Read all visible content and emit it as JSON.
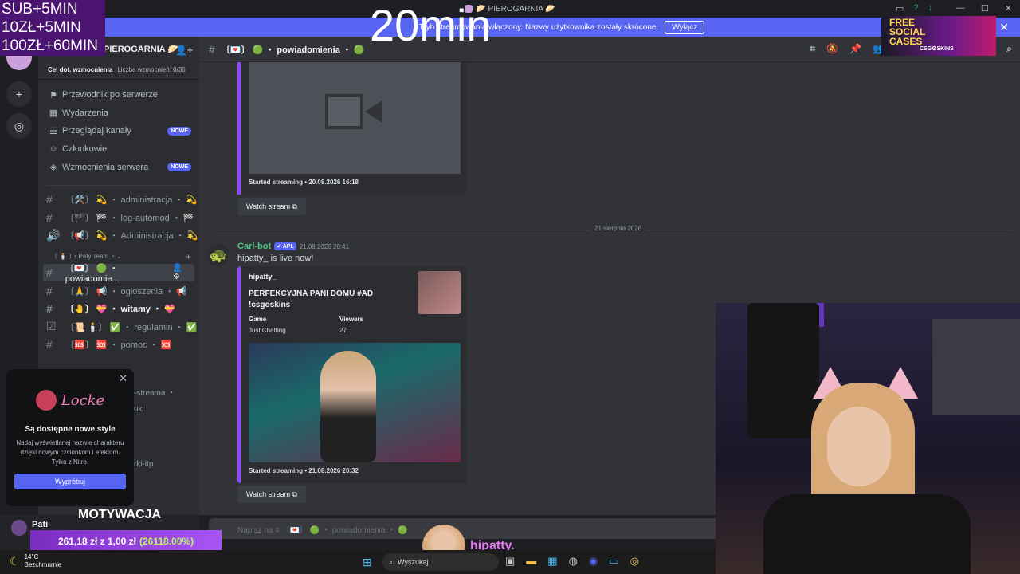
{
  "window": {
    "title": "🥟 PIEROGARNIA 🥟",
    "controls": [
      "—",
      "☐",
      "✕"
    ]
  },
  "notice": {
    "text": "Tryb streamowania włączony. Nazwy użytkownika zostały skrócone.",
    "button": "Wyłącz"
  },
  "server": {
    "name": "PIEROGARNIA 🥟",
    "boost_goal": "Cel dot. wzmocnienia",
    "boost_count": "Liczba wzmocnień: 0/36"
  },
  "nav": [
    {
      "icon": "compass-icon",
      "glyph": "⚑",
      "label": "Przewodnik po serwerze",
      "badge": ""
    },
    {
      "icon": "calendar-icon",
      "glyph": "▦",
      "label": "Wydarzenia",
      "badge": ""
    },
    {
      "icon": "browse-icon",
      "glyph": "☰",
      "label": "Przeglądaj kanały",
      "badge": "NOWE"
    },
    {
      "icon": "members-icon",
      "glyph": "☺",
      "label": "Członkowie",
      "badge": ""
    },
    {
      "icon": "boost-icon",
      "glyph": "◈",
      "label": "Wzmocnienia serwera",
      "badge": "NOWE"
    }
  ],
  "channels_top": [
    {
      "prefix": "#",
      "label": "〔🛠️〕 💫 ・ administracja ・ 💫"
    },
    {
      "prefix": "#",
      "label": "〔🏴〕 🏁 ・ log-automod ・ 🏁"
    },
    {
      "prefix": "🔊",
      "label": "〔📢〕 💫 ・ Administracja ・ 💫"
    }
  ],
  "category": {
    "label": "〔 🕯️ 〕・Paty Team ・"
  },
  "channels_team": [
    {
      "prefix": "#",
      "label": "〔💌〕 🟢 ・ powiadomie...",
      "state": "active"
    },
    {
      "prefix": "#",
      "label": "〔🙏〕 📢 ・ ogłoszenia ・ 📢",
      "state": "normal"
    },
    {
      "prefix": "#",
      "label": "〔🤚〕 💝 ・ witamy ・ 💝",
      "state": "bold"
    },
    {
      "prefix": "☑",
      "label": "〔📜 🕯️〕 ✅ ・ regulamin ・ ✅",
      "state": "normal"
    },
    {
      "prefix": "#",
      "label": "〔🆘〕 🆘 ・ pomoc ・ 🆘",
      "state": "normal"
    }
  ],
  "partial_channels": [
    "-streama ・",
    "uki",
    "rki-itp"
  ],
  "popup": {
    "logo": "Locke",
    "title": "Są dostępne nowe style",
    "body": "Nadaj wyświetlanej nazwie charakteru dzięki nowym czcionkom i efektom. Tylko z Nitro.",
    "button": "Wypróbuj"
  },
  "user": {
    "name": "Pati"
  },
  "chat": {
    "channel": "〔💌〕 🟢 ・ powiadomienia ・ 🟢",
    "embed1_footer": "Started streaming • 20.08.2026 16:18",
    "watch_label": "Watch stream",
    "date_divider": "21 sierpnia 2026",
    "message": {
      "author": "Carl-bot",
      "app_badge": "✔ APL",
      "timestamp": "21.08.2026 20:41",
      "text": "hipatty_ is live now!"
    },
    "embed2": {
      "author": "hipatty_",
      "title": "PERFEKCYJNA PANI DOMU #AD !csgoskins",
      "game_label": "Game",
      "game_value": "Just Chatting",
      "viewers_label": "Viewers",
      "viewers_value": "27",
      "footer": "Started streaming • 21.08.2026 20:32"
    },
    "composer_placeholder": "Napisz na # 〔💌〕 🟢 ・ powiadomienia ・ 🟢"
  },
  "overlay": {
    "rules": [
      "SUB+5MIN",
      "10ZŁ+5MIN",
      "100ZŁ+60MIN"
    ],
    "timer": "20min",
    "ad_line1": "FREE",
    "ad_line2": "SOCIAL",
    "ad_line3": "CASES",
    "ad_brand": "CSG⚙SKINS",
    "motivation": "MOTYWACJA",
    "goal_amount": "261,18 zł z 1,00 zł",
    "goal_percent": "(26118.00%)",
    "streamer": "hipatty."
  },
  "taskbar": {
    "temp": "14°C",
    "weather": "Bezchmurnie",
    "search": "Wyszukaj"
  }
}
